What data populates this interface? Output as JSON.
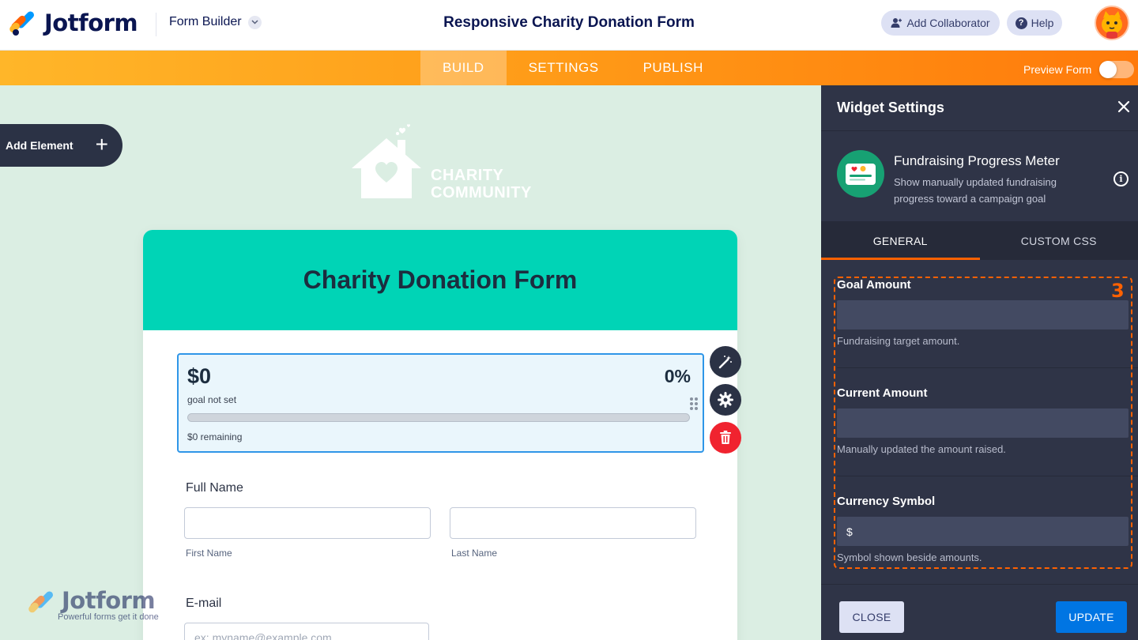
{
  "app": {
    "brand": "Jotform",
    "mode_selector": "Form Builder",
    "form_title": "Responsive Charity Donation Form",
    "add_collaborator": "Add Collaborator",
    "help": "Help"
  },
  "nav": {
    "tabs": [
      {
        "label": "BUILD",
        "active": true
      },
      {
        "label": "SETTINGS",
        "active": false
      },
      {
        "label": "PUBLISH",
        "active": false
      }
    ],
    "preview_label": "Preview Form",
    "preview_enabled": false
  },
  "sidebar": {
    "add_element_label": "Add Element"
  },
  "form": {
    "logo_line1": "CHARITY",
    "logo_line2": "COMMUNITY",
    "header_title": "Charity Donation Form",
    "widget": {
      "amount": "$0",
      "percent": "0%",
      "goal_note": "goal not set",
      "progress": 0,
      "remaining": "$0 remaining"
    },
    "full_name": {
      "label": "Full Name",
      "first_sublabel": "First Name",
      "last_sublabel": "Last Name"
    },
    "email": {
      "label": "E-mail",
      "placeholder": "ex: myname@example.com"
    }
  },
  "watermark": {
    "brand": "Jotform",
    "tagline": "Powerful forms get it done"
  },
  "panel": {
    "title": "Widget Settings",
    "widget_name": "Fundraising Progress Meter",
    "widget_description": "Show manually updated fundraising progress toward a campaign goal",
    "tabs": [
      {
        "label": "GENERAL",
        "active": true
      },
      {
        "label": "CUSTOM CSS",
        "active": false
      }
    ],
    "settings": [
      {
        "label": "Goal Amount",
        "value": "",
        "help": "Fundraising target amount."
      },
      {
        "label": "Current Amount",
        "value": "",
        "help": "Manually updated the amount raised."
      },
      {
        "label": "Currency Symbol",
        "value": "$",
        "help": "Symbol shown beside amounts."
      }
    ],
    "step_number": "3",
    "close_button": "CLOSE",
    "update_button": "UPDATE"
  },
  "colors": {
    "accent_orange": "#ff6100",
    "header_teal": "#00d4b6",
    "panel_bg": "#2f3447",
    "update_blue": "#0075e3",
    "delete_red": "#f0232f"
  }
}
